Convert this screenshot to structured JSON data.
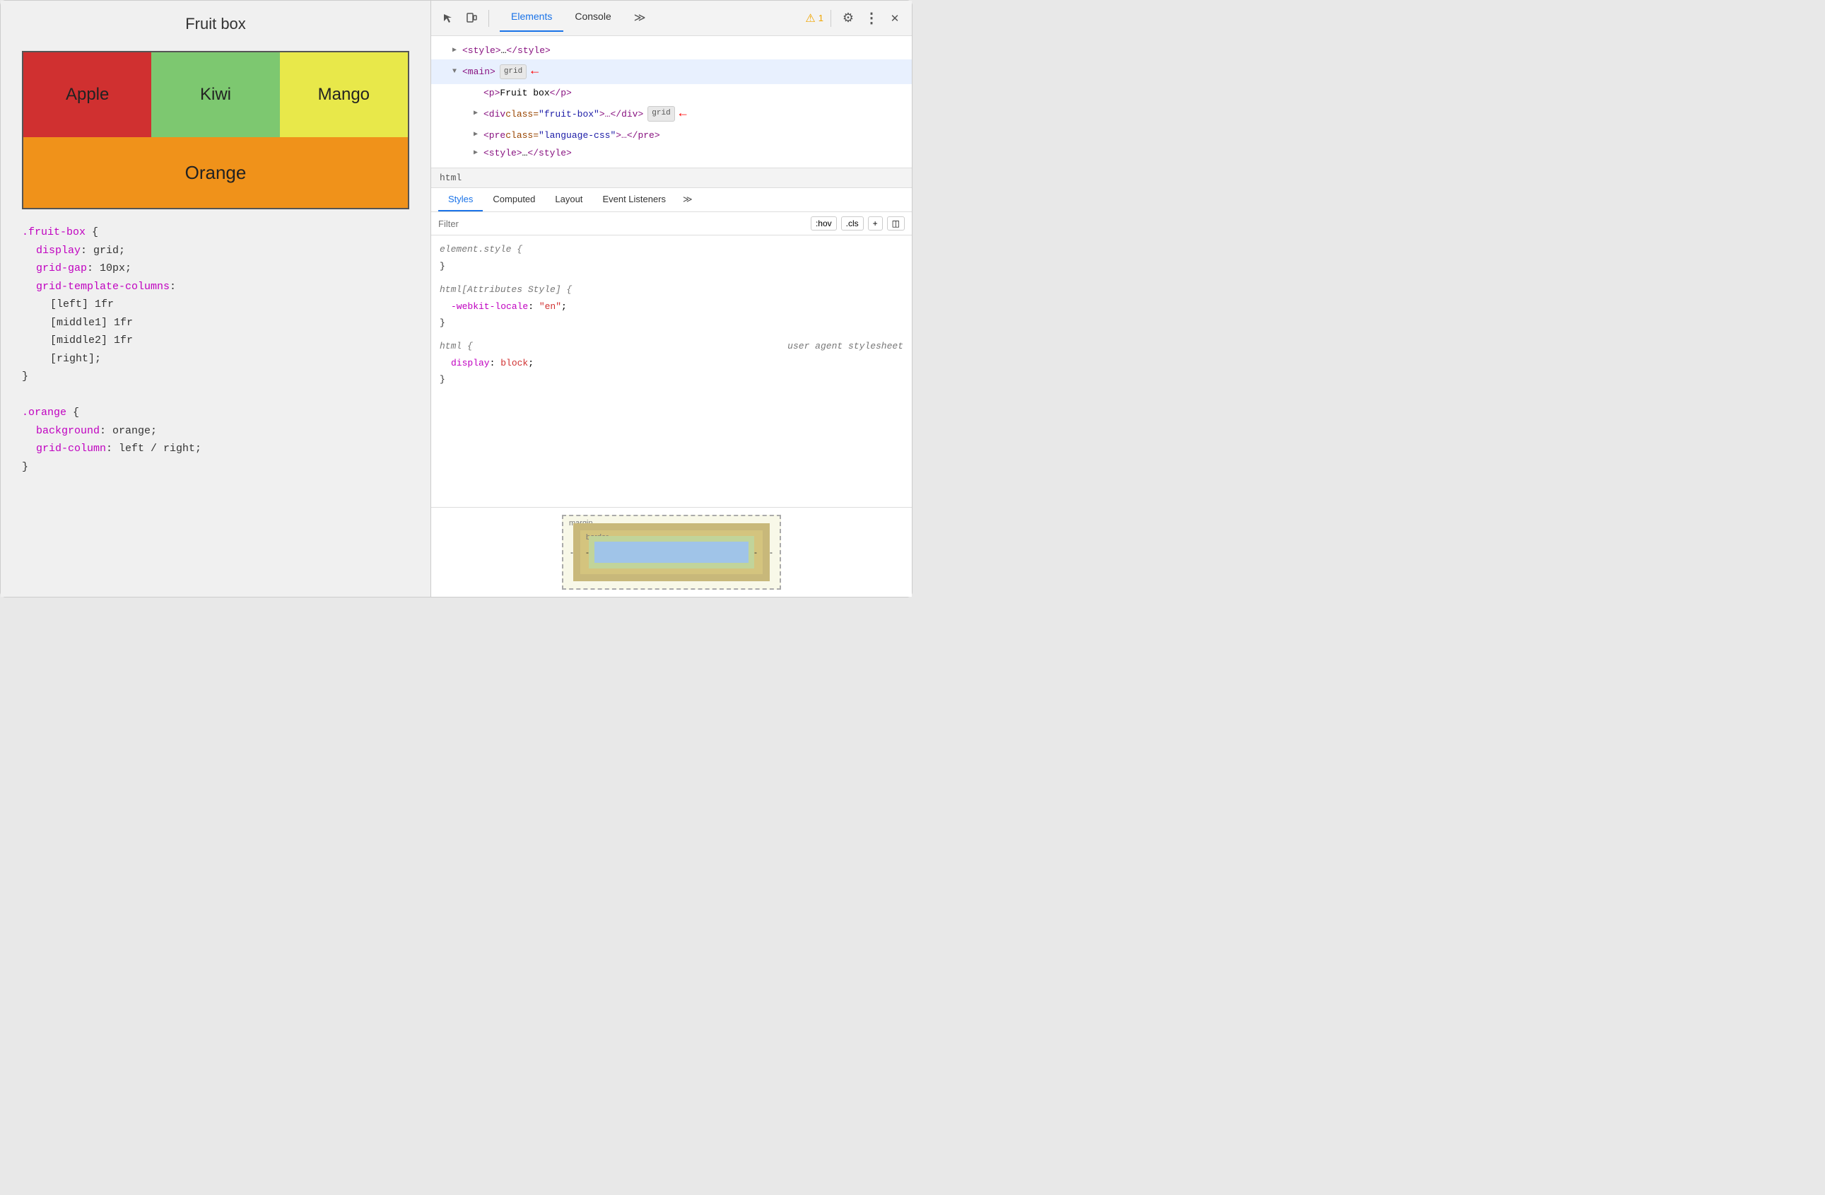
{
  "left": {
    "title": "Fruit box",
    "fruits": {
      "apple": "Apple",
      "kiwi": "Kiwi",
      "mango": "Mango",
      "orange": "Orange"
    },
    "code": {
      "block1": {
        "selector": ".fruit-box {",
        "lines": [
          "display: grid;",
          "grid-gap: 10px;",
          "grid-template-columns:",
          "    [left] 1fr",
          "    [middle1] 1fr",
          "    [middle2] 1fr",
          "    [right];",
          "}"
        ]
      },
      "block2": {
        "selector": ".orange {",
        "lines": [
          "background: orange;",
          "grid-column: left / right;",
          "}"
        ]
      }
    }
  },
  "devtools": {
    "toolbar": {
      "tabs": [
        "Elements",
        "Console"
      ],
      "active_tab": "Elements",
      "more_icon": "≫",
      "warning_count": "1",
      "settings_icon": "⚙",
      "more_options_icon": "⋮",
      "close_icon": "✕"
    },
    "dom": {
      "rows": [
        {
          "indent": 10,
          "triangle": "▶",
          "content": "<style>…</style>",
          "badge": null,
          "arrow": false
        },
        {
          "indent": 10,
          "triangle": "▼",
          "content": "<main>",
          "badge": "grid",
          "arrow": true
        },
        {
          "indent": 30,
          "triangle": "",
          "content": "<p>Fruit box</p>",
          "badge": null,
          "arrow": false
        },
        {
          "indent": 30,
          "triangle": "▶",
          "content": "<div class=\"fruit-box\">…</div>",
          "badge": "grid",
          "arrow": true
        },
        {
          "indent": 30,
          "triangle": "▶",
          "content": "<pre class=\"language-css\">…</pre>",
          "badge": null,
          "arrow": false
        },
        {
          "indent": 30,
          "triangle": "▶",
          "content": "<style>…</style>",
          "badge": null,
          "arrow": false
        }
      ]
    },
    "breadcrumb": "html",
    "styles_tabs": [
      "Styles",
      "Computed",
      "Layout",
      "Event Listeners"
    ],
    "active_styles_tab": "Styles",
    "filter": {
      "placeholder": "Filter",
      "hov_btn": ":hov",
      "cls_btn": ".cls",
      "plus_btn": "+",
      "layout_btn": "◫"
    },
    "style_rules": [
      {
        "selector": "element.style {",
        "close": "}",
        "properties": []
      },
      {
        "selector": "html[Attributes Style] {",
        "close": "}",
        "properties": [
          {
            "name": "-webkit-locale",
            "value": "\"en\"",
            "color": "red"
          }
        ]
      },
      {
        "selector": "html {",
        "source": "user agent stylesheet",
        "close": "}",
        "properties": [
          {
            "name": "display",
            "value": "block",
            "color": "red"
          }
        ]
      }
    ],
    "box_model": {
      "margin_label": "margin",
      "margin_value": "-",
      "border_label": "border",
      "border_value": "-"
    }
  }
}
